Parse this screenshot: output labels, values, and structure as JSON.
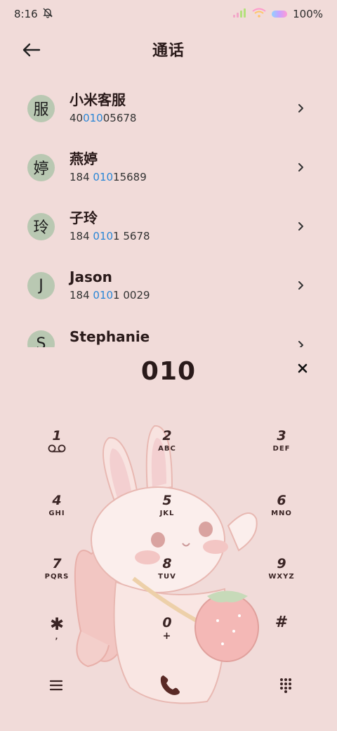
{
  "status": {
    "time": "8:16",
    "battery": "100%"
  },
  "header": {
    "title": "通话"
  },
  "contacts": [
    {
      "avatar": "服",
      "name": "小米客服",
      "num_pre": "40",
      "num_hl": "010",
      "num_post": "05678"
    },
    {
      "avatar": "婷",
      "name": "燕婷",
      "num_pre": "184 ",
      "num_hl": "010",
      "num_post": "15689"
    },
    {
      "avatar": "玲",
      "name": "子玲",
      "num_pre": "184 ",
      "num_hl": "010",
      "num_post": "1 5678"
    },
    {
      "avatar": "J",
      "name": "Jason",
      "num_pre": "184 ",
      "num_hl": "010",
      "num_post": "1 0029"
    },
    {
      "avatar": "S",
      "name": "Stephanie",
      "num_pre": "",
      "num_hl": "",
      "num_post": ""
    }
  ],
  "dial": {
    "number": "010"
  },
  "keypad": [
    {
      "digit": "1",
      "letters": ""
    },
    {
      "digit": "2",
      "letters": "ABC"
    },
    {
      "digit": "3",
      "letters": "DEF"
    },
    {
      "digit": "4",
      "letters": "GHI"
    },
    {
      "digit": "5",
      "letters": "JKL"
    },
    {
      "digit": "6",
      "letters": "MNO"
    },
    {
      "digit": "7",
      "letters": "PQRS"
    },
    {
      "digit": "8",
      "letters": "TUV"
    },
    {
      "digit": "9",
      "letters": "WXYZ"
    },
    {
      "digit": "✱",
      "letters": ","
    },
    {
      "digit": "0",
      "letters": "+"
    },
    {
      "digit": "#",
      "letters": ""
    }
  ],
  "colors": {
    "background": "#f1dbd9",
    "highlight": "#2a86d6",
    "avatar": "#b9c8b2",
    "call": "#5a2a26"
  }
}
